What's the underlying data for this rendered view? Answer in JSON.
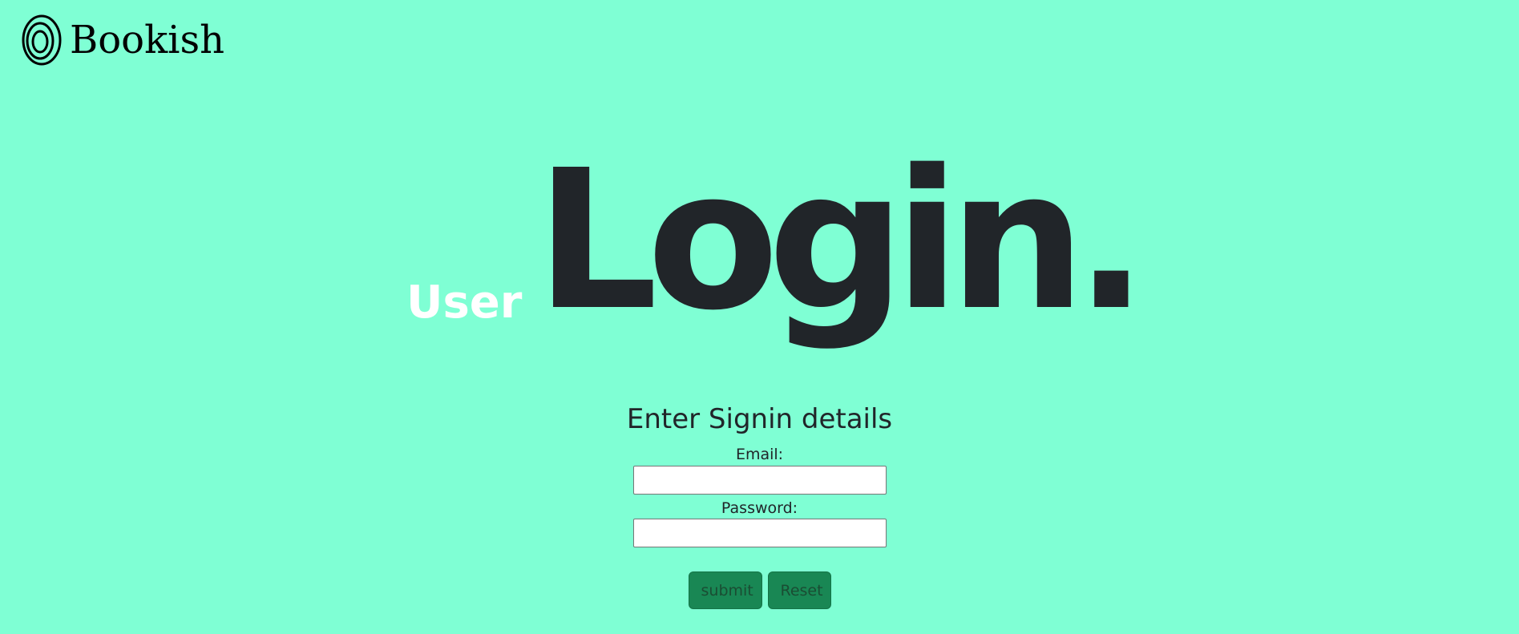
{
  "brand": {
    "name": "Bookish",
    "icon": "spiral-rings-icon"
  },
  "hero": {
    "small": "User",
    "big": "Login."
  },
  "form": {
    "title": "Enter Signin details",
    "email_label": "Email:",
    "email_value": "",
    "password_label": "Password:",
    "password_value": "",
    "submit_label": "submit",
    "reset_label": "Reset"
  },
  "colors": {
    "background": "#7fffd4",
    "text": "#212529",
    "accent": "#198754",
    "hero_small": "#ffffff"
  }
}
